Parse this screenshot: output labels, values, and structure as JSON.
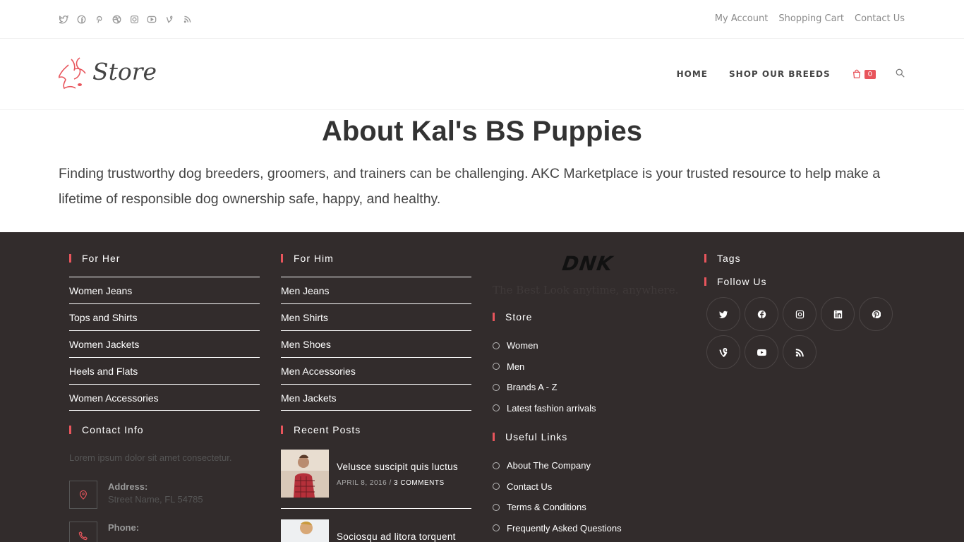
{
  "topbar": {
    "social_icons": [
      "twitter-icon",
      "facebook-icon",
      "pinterest-icon",
      "dribbble-icon",
      "instagram-icon",
      "youtube-icon",
      "vine-icon",
      "rss-icon"
    ],
    "links": [
      "My Account",
      "Shopping Cart",
      "Contact Us"
    ]
  },
  "header": {
    "logo_text": "Store",
    "nav": [
      "HOME",
      "SHOP OUR BREEDS"
    ],
    "cart_count": "0"
  },
  "hero": {
    "title": "About Kal's BS Puppies",
    "text": "Finding trustworthy dog breeders, groomers, and trainers can be challenging. AKC Marketplace is your trusted resource to help make a lifetime of responsible dog ownership safe, happy, and healthy."
  },
  "footer": {
    "for_her": {
      "title": "For Her",
      "items": [
        "Women Jeans",
        "Tops and Shirts",
        "Women Jackets",
        "Heels and Flats",
        "Women Accessories"
      ]
    },
    "for_him": {
      "title": "For Him",
      "items": [
        "Men Jeans",
        "Men Shirts",
        "Men Shoes",
        "Men Accessories",
        "Men Jackets"
      ]
    },
    "contact": {
      "title": "Contact Info",
      "intro": "Lorem ipsum dolor sit amet consectetur.",
      "address_label": "Address:",
      "address_value": "Street Name, FL 54785",
      "phone_label": "Phone:"
    },
    "recent": {
      "title": "Recent Posts",
      "posts": [
        {
          "title": "Velusce suscipit quis luctus",
          "date": "APRIL 8, 2016 /",
          "comments": "3 COMMENTS"
        },
        {
          "title": "Sociosqu ad litora torquent"
        }
      ]
    },
    "brand": {
      "logo_text": "DNK",
      "tagline": "The Best Look anytime, anywhere."
    },
    "store": {
      "title": "Store",
      "items": [
        "Women",
        "Men",
        "Brands A - Z",
        "Latest fashion arrivals"
      ]
    },
    "useful": {
      "title": "Useful Links",
      "items": [
        "About The Company",
        "Contact Us",
        "Terms & Conditions",
        "Frequently Asked Questions"
      ]
    },
    "tags": {
      "title": "Tags"
    },
    "follow": {
      "title": "Follow Us",
      "icons": [
        "twitter-icon",
        "facebook-icon",
        "instagram-icon",
        "linkedin-icon",
        "pinterest-icon",
        "vine-icon",
        "youtube-icon",
        "rss-icon"
      ]
    }
  },
  "colors": {
    "accent": "#e8555c",
    "footer_bg": "#322c2c"
  }
}
